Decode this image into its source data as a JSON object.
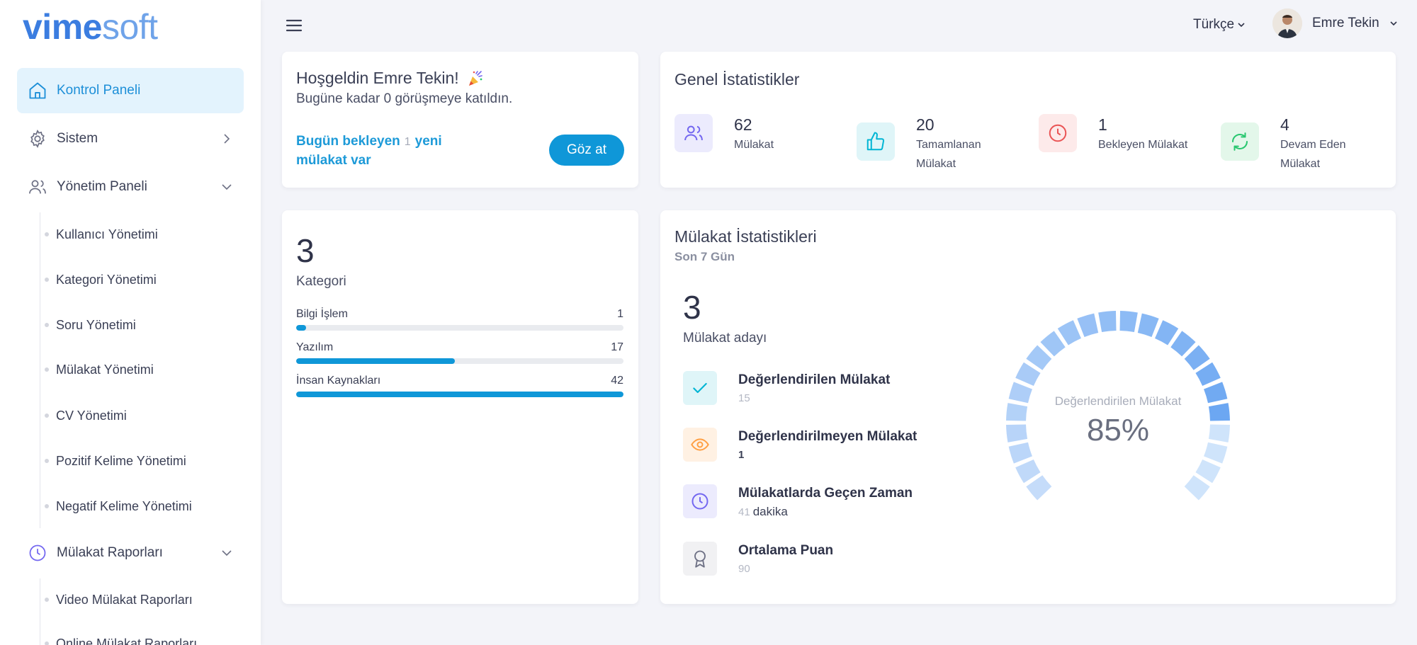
{
  "brand": {
    "part1": "vime",
    "part2": "soft"
  },
  "sidebar": {
    "items": [
      {
        "label": "Kontrol Paneli",
        "icon": "home-icon",
        "active": true
      },
      {
        "label": "Sistem",
        "icon": "gear-icon"
      },
      {
        "label": "Yönetim Paneli",
        "icon": "users-icon"
      },
      {
        "label": "Mülakat Raporları",
        "icon": "clock-icon"
      }
    ],
    "yonetim_sub": [
      "Kullanıcı Yönetimi",
      "Kategori Yönetimi",
      "Soru Yönetimi",
      "Mülakat Yönetimi",
      "CV Yönetimi",
      "Pozitif Kelime Yönetimi",
      "Negatif Kelime Yönetimi"
    ],
    "rapor_sub": [
      "Video Mülakat Raporları",
      "Online Mülakat Raporları"
    ]
  },
  "topbar": {
    "language": "Türkçe",
    "user_name": "Emre Tekin"
  },
  "welcome": {
    "title": "Hoşgeldin Emre Tekin!",
    "subtitle": "Bugüne kadar 0 görüşmeye katıldın.",
    "pending_prefix": "Bugün bekleyen",
    "pending_count": "1",
    "pending_suffix": "yeni mülakat var",
    "button": "Göz at"
  },
  "general_stats": {
    "title": "Genel İstatistikler",
    "items": [
      {
        "value": "62",
        "label": "Mülakat",
        "icon": "users-icon",
        "bg": "#ecebfd",
        "color": "#7367f0"
      },
      {
        "value": "20",
        "label": "Tamamlanan Mülakat",
        "icon": "thumbs-up-icon",
        "bg": "#dff5f8",
        "color": "#00b5d4"
      },
      {
        "value": "1",
        "label": "Bekleyen Mülakat",
        "icon": "clock-icon",
        "bg": "#fdeaea",
        "color": "#ea5455"
      },
      {
        "value": "4",
        "label": "Devam Eden Mülakat",
        "icon": "refresh-icon",
        "bg": "#e3f7ea",
        "color": "#28c76f"
      }
    ]
  },
  "categories": {
    "count": "3",
    "label": "Kategori",
    "items": [
      {
        "name": "Bilgi İşlem",
        "value": "1",
        "fill": 0.03
      },
      {
        "name": "Yazılım",
        "value": "17",
        "fill": 0.485
      },
      {
        "name": "İnsan Kaynakları",
        "value": "42",
        "fill": 1.0
      }
    ]
  },
  "interview_stats": {
    "title": "Mülakat İstatistikleri",
    "subtitle": "Son 7 Gün",
    "count": "3",
    "count_label": "Mülakat adayı",
    "rows": [
      {
        "title": "Değerlendirilen Mülakat",
        "value": "15",
        "unit": "",
        "icon": "check-icon",
        "bg": "#dff5f8",
        "color": "#00b5d4",
        "dark": false
      },
      {
        "title": "Değerlendirilmeyen Mülakat",
        "value": "1",
        "unit": "",
        "icon": "eye-icon",
        "bg": "#fff1e3",
        "color": "#ff9f43",
        "dark": true
      },
      {
        "title": "Mülakatlarda Geçen Zaman",
        "value": "41",
        "unit": "dakika",
        "icon": "clock-icon",
        "bg": "#ecebfd",
        "color": "#7367f0",
        "dark": false
      },
      {
        "title": "Ortalama Puan",
        "value": "90",
        "unit": "",
        "icon": "award-icon",
        "bg": "#f1f1f3",
        "color": "#6e7185",
        "dark": false
      }
    ],
    "gauge": {
      "label": "Değerlendirilen Mülakat",
      "value_text": "85%",
      "percent": 85,
      "color_active": "#5a9cf0",
      "color_rest": "#cfe4fb"
    }
  }
}
